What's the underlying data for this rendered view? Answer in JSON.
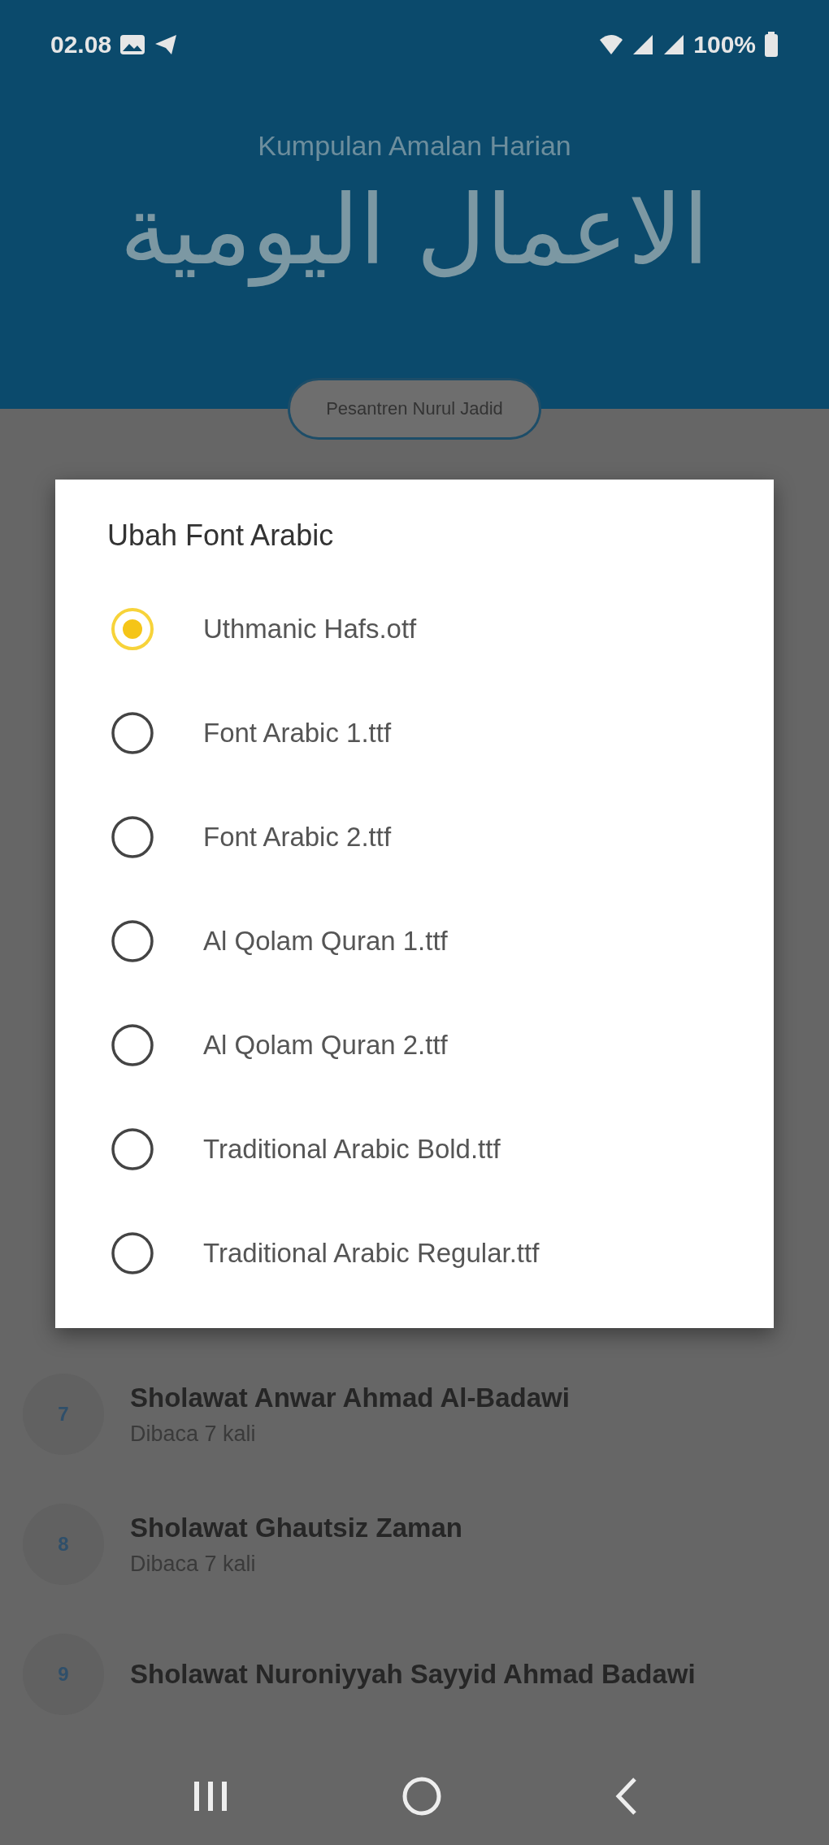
{
  "status_bar": {
    "time": "02.08",
    "battery": "100%"
  },
  "header": {
    "subtitle": "Kumpulan Amalan Harian",
    "title_arabic": "الاعمال اليومية",
    "button": "Pesantren Nurul Jadid"
  },
  "dialog": {
    "title": "Ubah Font Arabic",
    "options": [
      {
        "label": "Uthmanic Hafs.otf",
        "selected": true
      },
      {
        "label": "Font Arabic 1.ttf",
        "selected": false
      },
      {
        "label": "Font Arabic 2.ttf",
        "selected": false
      },
      {
        "label": "Al Qolam Quran 1.ttf",
        "selected": false
      },
      {
        "label": "Al Qolam Quran 2.ttf",
        "selected": false
      },
      {
        "label": "Traditional Arabic Bold.ttf",
        "selected": false
      },
      {
        "label": "Traditional Arabic Regular.ttf",
        "selected": false
      }
    ]
  },
  "list": [
    {
      "number": "7",
      "title": "Sholawat Anwar Ahmad Al-Badawi",
      "subtitle": "Dibaca 7 kali"
    },
    {
      "number": "8",
      "title": "Sholawat Ghautsiz Zaman",
      "subtitle": "Dibaca 7 kali"
    },
    {
      "number": "9",
      "title": "Sholawat Nuroniyyah Sayyid Ahmad Badawi"
    }
  ]
}
